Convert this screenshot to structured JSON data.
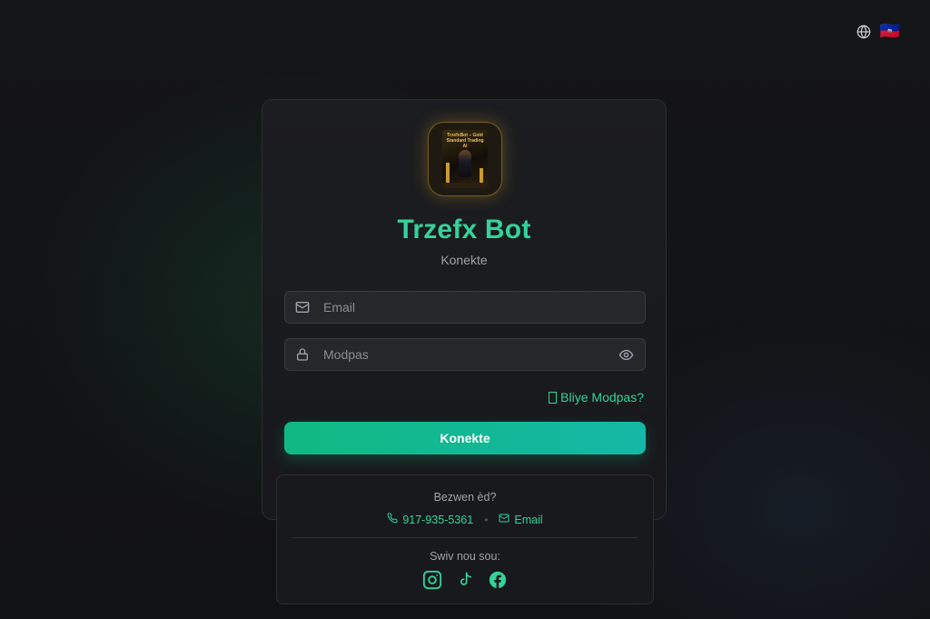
{
  "header": {
    "globe_icon": "globe-icon",
    "language_flag": "🇭🇹"
  },
  "login": {
    "app_title": "Trzefx Bot",
    "subtitle": "Konekte",
    "logo_text": "TrzefxBot – Gold Standard Trading AI",
    "email": {
      "placeholder": "Email",
      "value": "",
      "icon": "mail-icon"
    },
    "password": {
      "placeholder": "Modpas",
      "value": "",
      "icon": "lock-icon",
      "toggle_icon": "eye-icon"
    },
    "forgot_label": "Bliye Modpas?",
    "submit_label": "Konekte"
  },
  "contact": {
    "question": "Bezwen èd?",
    "phone": "917-935-5361",
    "separator": "•",
    "email_label": "Email",
    "follow_label": "Swiv nou sou:",
    "socials": [
      "instagram-icon",
      "tiktok-icon",
      "facebook-icon"
    ]
  },
  "colors": {
    "accent": "#34d399",
    "button_start": "#10b981",
    "button_end": "#14b8a6",
    "background": "#121315"
  }
}
